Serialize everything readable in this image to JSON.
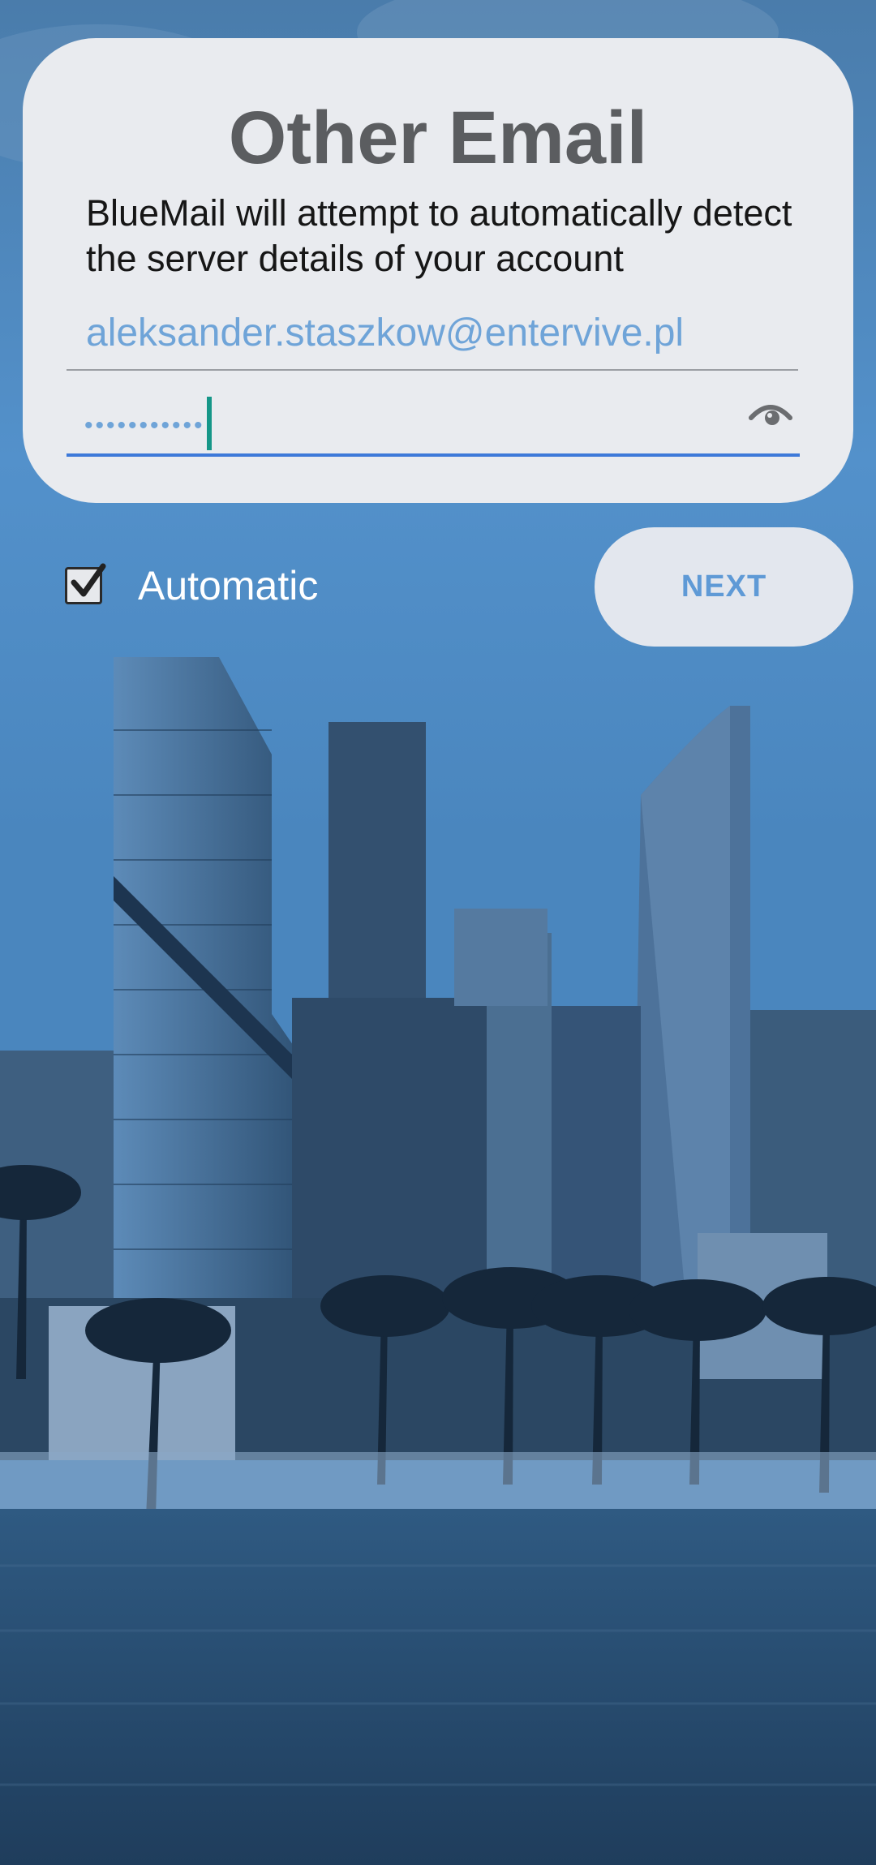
{
  "card": {
    "title": "Other Email",
    "description": "BlueMail will attempt to automatically detect the server details of your account",
    "email_value": "aleksander.staszkow@entervive.pl",
    "password_masked": "•••••••••••"
  },
  "options": {
    "automatic_label": "Automatic",
    "automatic_checked": true
  },
  "actions": {
    "next_label": "NEXT"
  },
  "icons": {
    "password_toggle": "eye-icon",
    "checkbox": "check-icon"
  },
  "colors": {
    "accent": "#3d79d9",
    "cursor": "#159688",
    "field_text": "#6fa4d8",
    "title": "#5b5d60"
  }
}
